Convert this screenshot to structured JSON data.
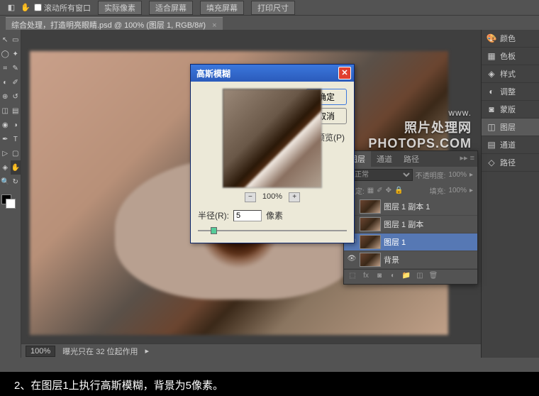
{
  "toolbar": {
    "scroll_checkbox": "滚动所有窗口",
    "buttons": [
      "实际像素",
      "适合屏幕",
      "填充屏幕",
      "打印尺寸"
    ]
  },
  "doc_tab": {
    "title": "综合处理，打造明亮眼睛.psd @ 100% (图层 1, RGB/8#)",
    "close": "×"
  },
  "status": {
    "zoom": "100%",
    "info": "曝光只在 32 位起作用"
  },
  "right_rail": {
    "items": [
      "颜色",
      "色板",
      "样式",
      "调整",
      "蒙版",
      "图层",
      "通道",
      "路径"
    ]
  },
  "layers_panel": {
    "tabs": [
      "图层",
      "通道",
      "路径"
    ],
    "blend_label": "正常",
    "opacity_label": "不透明度:",
    "opacity_value": "100%",
    "lock_label": "锁定:",
    "fill_label": "填充:",
    "fill_value": "100%",
    "layers": [
      {
        "name": "图层 1 副本 1"
      },
      {
        "name": "图层 1 副本"
      },
      {
        "name": "图层 1"
      },
      {
        "name": "背景"
      }
    ]
  },
  "watermark": {
    "sub": "www.",
    "main1": "照片处理网",
    "main2": "PHOTOPS.COM"
  },
  "dialog": {
    "title": "高斯模糊",
    "ok": "确定",
    "cancel": "取消",
    "preview_label": "预览(P)",
    "zoom_value": "100%",
    "radius_label": "半径(R):",
    "radius_value": "5",
    "radius_unit": "像素"
  },
  "caption": "2、在图层1上执行高斯模糊，背景为5像素。"
}
